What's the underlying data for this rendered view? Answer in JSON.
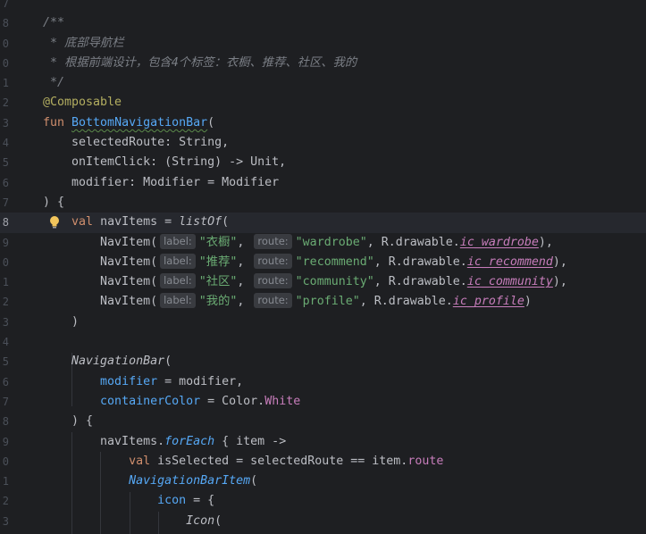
{
  "editor": {
    "lines": [
      {
        "n": "7",
        "parts": []
      },
      {
        "n": "8",
        "parts": [
          {
            "c": "c",
            "t": "/**"
          }
        ]
      },
      {
        "n": "0",
        "parts": [
          {
            "c": "c",
            "t": " * 底部导航栏"
          }
        ]
      },
      {
        "n": "0",
        "parts": [
          {
            "c": "c",
            "t": " * 根据前端设计，包含4个标签：衣橱、推荐、社区、我的"
          }
        ]
      },
      {
        "n": "1",
        "parts": [
          {
            "c": "c",
            "t": " */"
          }
        ]
      },
      {
        "n": "2",
        "parts": [
          {
            "c": "ann",
            "t": "@Composable"
          }
        ]
      },
      {
        "n": "3",
        "parts": [
          {
            "c": "k",
            "t": "fun "
          },
          {
            "c": "fndecl",
            "t": "BottomNavigationBar"
          },
          {
            "c": "",
            "t": "("
          }
        ]
      },
      {
        "n": "4",
        "parts": [
          {
            "c": "",
            "t": "    selectedRoute: String,"
          }
        ]
      },
      {
        "n": "5",
        "parts": [
          {
            "c": "",
            "t": "    onItemClick: (String) -> Unit,"
          }
        ]
      },
      {
        "n": "6",
        "parts": [
          {
            "c": "",
            "t": "    modifier: Modifier = Modifier"
          }
        ]
      },
      {
        "n": "7",
        "parts": [
          {
            "c": "",
            "t": ") {"
          }
        ]
      },
      {
        "n": "8",
        "current": true,
        "bulb": true,
        "parts": [
          {
            "c": "",
            "t": "    "
          },
          {
            "c": "k",
            "t": "val "
          },
          {
            "c": "",
            "t": "navItems = "
          },
          {
            "c": "it",
            "t": "listOf"
          },
          {
            "c": "",
            "t": "("
          }
        ]
      },
      {
        "n": "9",
        "parts": [
          {
            "c": "",
            "t": "        NavItem("
          },
          {
            "c": "hint",
            "t": "label:"
          },
          {
            "c": "s",
            "t": "\"衣橱\""
          },
          {
            "c": "",
            "t": ", "
          },
          {
            "c": "hint",
            "t": "route:"
          },
          {
            "c": "s",
            "t": "\"wardrobe\""
          },
          {
            "c": "",
            "t": ", R.drawable."
          },
          {
            "c": "res",
            "t": "ic_wardrobe"
          },
          {
            "c": "",
            "t": "),"
          }
        ]
      },
      {
        "n": "0",
        "parts": [
          {
            "c": "",
            "t": "        NavItem("
          },
          {
            "c": "hint",
            "t": "label:"
          },
          {
            "c": "s",
            "t": "\"推荐\""
          },
          {
            "c": "",
            "t": ", "
          },
          {
            "c": "hint",
            "t": "route:"
          },
          {
            "c": "s",
            "t": "\"recommend\""
          },
          {
            "c": "",
            "t": ", R.drawable."
          },
          {
            "c": "res",
            "t": "ic_recommend"
          },
          {
            "c": "",
            "t": "),"
          }
        ]
      },
      {
        "n": "1",
        "parts": [
          {
            "c": "",
            "t": "        NavItem("
          },
          {
            "c": "hint",
            "t": "label:"
          },
          {
            "c": "s",
            "t": "\"社区\""
          },
          {
            "c": "",
            "t": ", "
          },
          {
            "c": "hint",
            "t": "route:"
          },
          {
            "c": "s",
            "t": "\"community\""
          },
          {
            "c": "",
            "t": ", R.drawable."
          },
          {
            "c": "res",
            "t": "ic_community"
          },
          {
            "c": "",
            "t": "),"
          }
        ]
      },
      {
        "n": "2",
        "parts": [
          {
            "c": "",
            "t": "        NavItem("
          },
          {
            "c": "hint",
            "t": "label:"
          },
          {
            "c": "s",
            "t": "\"我的\""
          },
          {
            "c": "",
            "t": ", "
          },
          {
            "c": "hint",
            "t": "route:"
          },
          {
            "c": "s",
            "t": "\"profile\""
          },
          {
            "c": "",
            "t": ", R.drawable."
          },
          {
            "c": "res",
            "t": "ic_profile"
          },
          {
            "c": "",
            "t": ")"
          }
        ]
      },
      {
        "n": "3",
        "parts": [
          {
            "c": "",
            "t": "    )"
          }
        ]
      },
      {
        "n": "4",
        "parts": []
      },
      {
        "n": "5",
        "parts": [
          {
            "c": "",
            "t": "    "
          },
          {
            "c": "comp",
            "t": "NavigationBar"
          },
          {
            "c": "",
            "t": "("
          }
        ]
      },
      {
        "n": "6",
        "parts": [
          {
            "c": "",
            "t": "        "
          },
          {
            "c": "fn",
            "t": "modifier"
          },
          {
            "c": "",
            "t": " = modifier,"
          }
        ]
      },
      {
        "n": "7",
        "parts": [
          {
            "c": "",
            "t": "        "
          },
          {
            "c": "fn",
            "t": "containerColor"
          },
          {
            "c": "",
            "t": " = Color."
          },
          {
            "c": "white",
            "t": "White"
          }
        ]
      },
      {
        "n": "8",
        "parts": [
          {
            "c": "",
            "t": "    ) {"
          }
        ]
      },
      {
        "n": "9",
        "parts": [
          {
            "c": "",
            "t": "        navItems."
          },
          {
            "c": "ital-fn",
            "t": "forEach"
          },
          {
            "c": "",
            "t": " { item ->"
          }
        ]
      },
      {
        "n": "0",
        "parts": [
          {
            "c": "",
            "t": "            "
          },
          {
            "c": "k",
            "t": "val "
          },
          {
            "c": "",
            "t": "isSelected = selectedRoute == item."
          },
          {
            "c": "p",
            "t": "route"
          }
        ]
      },
      {
        "n": "1",
        "parts": [
          {
            "c": "",
            "t": "            "
          },
          {
            "c": "ital-fn",
            "t": "NavigationBarItem"
          },
          {
            "c": "",
            "t": "("
          }
        ]
      },
      {
        "n": "2",
        "parts": [
          {
            "c": "",
            "t": "                "
          },
          {
            "c": "fn",
            "t": "icon"
          },
          {
            "c": "",
            "t": " = {"
          }
        ]
      },
      {
        "n": "3",
        "parts": [
          {
            "c": "",
            "t": "                    "
          },
          {
            "c": "comp",
            "t": "Icon"
          },
          {
            "c": "",
            "t": "("
          }
        ]
      }
    ]
  }
}
